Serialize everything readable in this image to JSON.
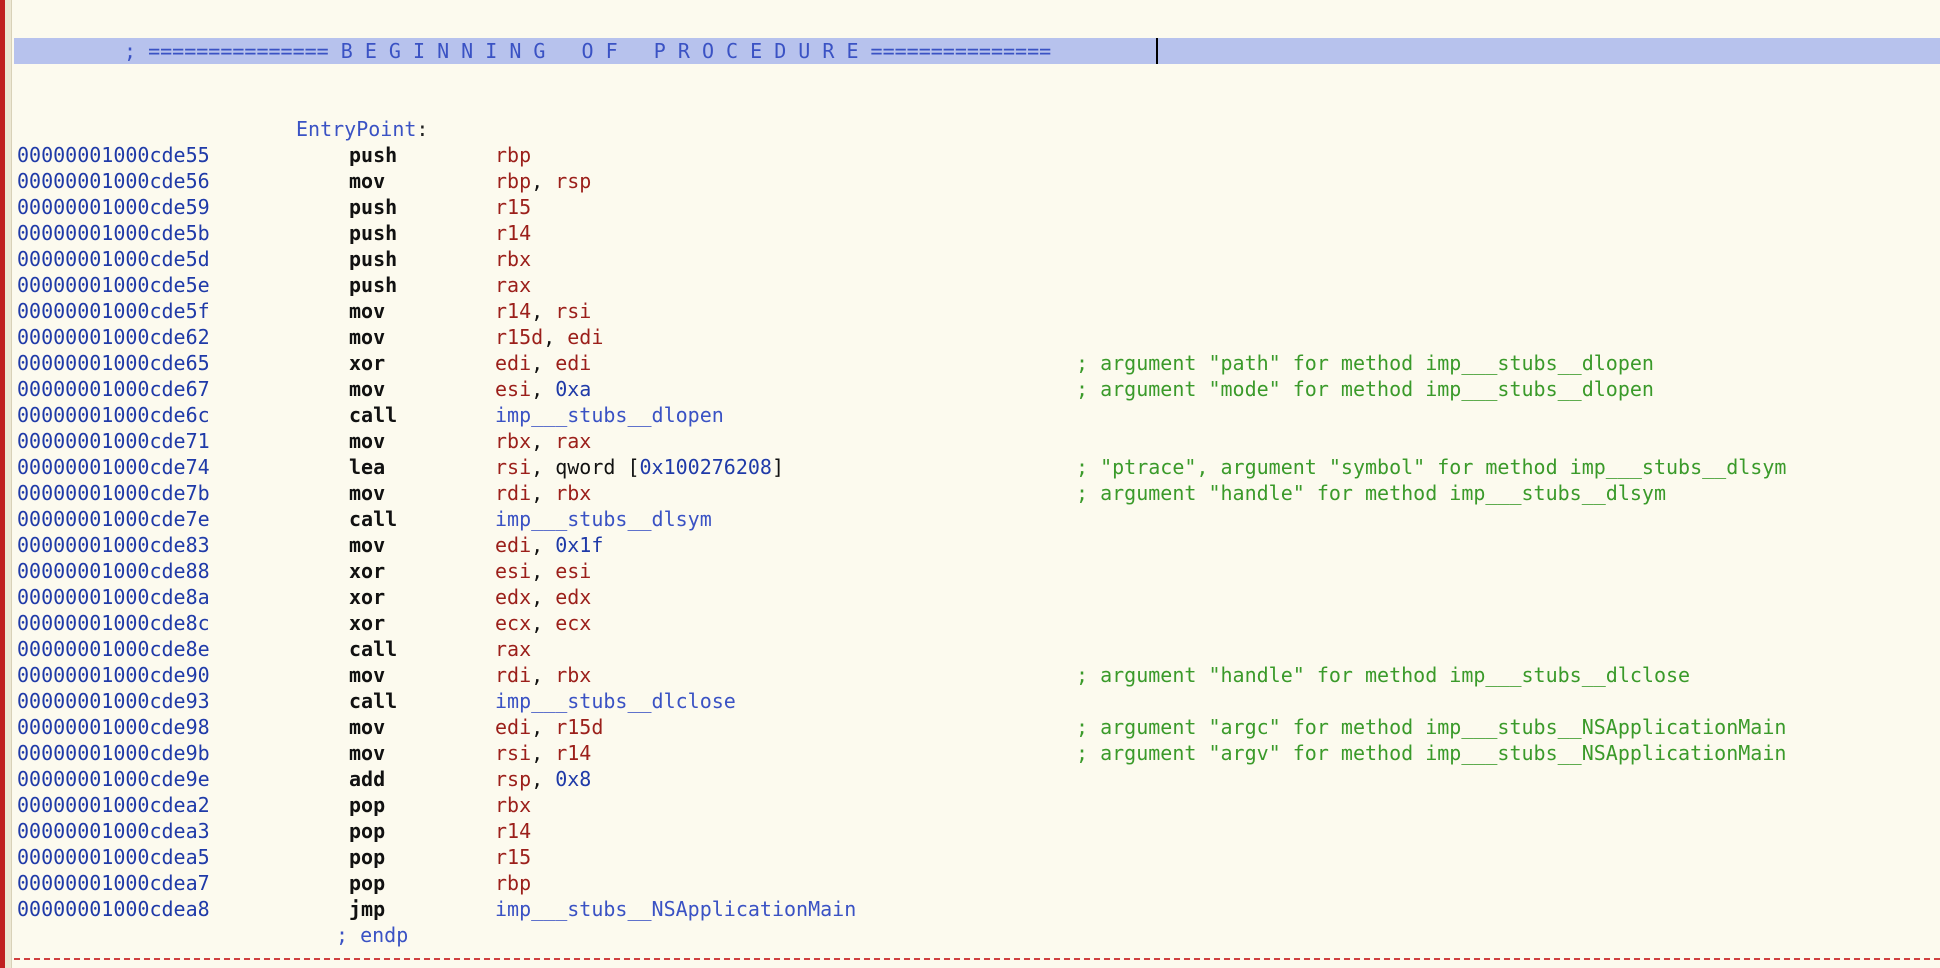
{
  "banner": {
    "text": "; =============== B E G I N N I N G   O F   P R O C E D U R E ==============="
  },
  "label": {
    "name": "EntryPoint",
    "colon": ":"
  },
  "instructions": [
    {
      "addr": "00000001000cde55",
      "mn": "push",
      "ops": [
        {
          "t": "reg",
          "v": "rbp"
        }
      ],
      "comment": ""
    },
    {
      "addr": "00000001000cde56",
      "mn": "mov",
      "ops": [
        {
          "t": "reg",
          "v": "rbp"
        },
        {
          "t": "sep",
          "v": ", "
        },
        {
          "t": "reg",
          "v": "rsp"
        }
      ],
      "comment": ""
    },
    {
      "addr": "00000001000cde59",
      "mn": "push",
      "ops": [
        {
          "t": "reg",
          "v": "r15"
        }
      ],
      "comment": ""
    },
    {
      "addr": "00000001000cde5b",
      "mn": "push",
      "ops": [
        {
          "t": "reg",
          "v": "r14"
        }
      ],
      "comment": ""
    },
    {
      "addr": "00000001000cde5d",
      "mn": "push",
      "ops": [
        {
          "t": "reg",
          "v": "rbx"
        }
      ],
      "comment": ""
    },
    {
      "addr": "00000001000cde5e",
      "mn": "push",
      "ops": [
        {
          "t": "reg",
          "v": "rax"
        }
      ],
      "comment": ""
    },
    {
      "addr": "00000001000cde5f",
      "mn": "mov",
      "ops": [
        {
          "t": "reg",
          "v": "r14"
        },
        {
          "t": "sep",
          "v": ", "
        },
        {
          "t": "reg",
          "v": "rsi"
        }
      ],
      "comment": ""
    },
    {
      "addr": "00000001000cde62",
      "mn": "mov",
      "ops": [
        {
          "t": "reg",
          "v": "r15d"
        },
        {
          "t": "sep",
          "v": ", "
        },
        {
          "t": "reg",
          "v": "edi"
        }
      ],
      "comment": ""
    },
    {
      "addr": "00000001000cde65",
      "mn": "xor",
      "ops": [
        {
          "t": "reg",
          "v": "edi"
        },
        {
          "t": "sep",
          "v": ", "
        },
        {
          "t": "reg",
          "v": "edi"
        }
      ],
      "comment": "; argument \"path\" for method imp___stubs__dlopen"
    },
    {
      "addr": "00000001000cde67",
      "mn": "mov",
      "ops": [
        {
          "t": "reg",
          "v": "esi"
        },
        {
          "t": "sep",
          "v": ", "
        },
        {
          "t": "num",
          "v": "0xa"
        }
      ],
      "comment": "; argument \"mode\" for method imp___stubs__dlopen"
    },
    {
      "addr": "00000001000cde6c",
      "mn": "call",
      "ops": [
        {
          "t": "sym",
          "v": "imp___stubs__dlopen"
        }
      ],
      "comment": ""
    },
    {
      "addr": "00000001000cde71",
      "mn": "mov",
      "ops": [
        {
          "t": "reg",
          "v": "rbx"
        },
        {
          "t": "sep",
          "v": ", "
        },
        {
          "t": "reg",
          "v": "rax"
        }
      ],
      "comment": ""
    },
    {
      "addr": "00000001000cde74",
      "mn": "lea",
      "ops": [
        {
          "t": "reg",
          "v": "rsi"
        },
        {
          "t": "sep",
          "v": ", "
        },
        {
          "t": "plain",
          "v": "qword ["
        },
        {
          "t": "num",
          "v": "0x100276208"
        },
        {
          "t": "plain",
          "v": "]"
        }
      ],
      "comment": "; \"ptrace\", argument \"symbol\" for method imp___stubs__dlsym"
    },
    {
      "addr": "00000001000cde7b",
      "mn": "mov",
      "ops": [
        {
          "t": "reg",
          "v": "rdi"
        },
        {
          "t": "sep",
          "v": ", "
        },
        {
          "t": "reg",
          "v": "rbx"
        }
      ],
      "comment": "; argument \"handle\" for method imp___stubs__dlsym"
    },
    {
      "addr": "00000001000cde7e",
      "mn": "call",
      "ops": [
        {
          "t": "sym",
          "v": "imp___stubs__dlsym"
        }
      ],
      "comment": ""
    },
    {
      "addr": "00000001000cde83",
      "mn": "mov",
      "ops": [
        {
          "t": "reg",
          "v": "edi"
        },
        {
          "t": "sep",
          "v": ", "
        },
        {
          "t": "num",
          "v": "0x1f"
        }
      ],
      "comment": ""
    },
    {
      "addr": "00000001000cde88",
      "mn": "xor",
      "ops": [
        {
          "t": "reg",
          "v": "esi"
        },
        {
          "t": "sep",
          "v": ", "
        },
        {
          "t": "reg",
          "v": "esi"
        }
      ],
      "comment": ""
    },
    {
      "addr": "00000001000cde8a",
      "mn": "xor",
      "ops": [
        {
          "t": "reg",
          "v": "edx"
        },
        {
          "t": "sep",
          "v": ", "
        },
        {
          "t": "reg",
          "v": "edx"
        }
      ],
      "comment": ""
    },
    {
      "addr": "00000001000cde8c",
      "mn": "xor",
      "ops": [
        {
          "t": "reg",
          "v": "ecx"
        },
        {
          "t": "sep",
          "v": ", "
        },
        {
          "t": "reg",
          "v": "ecx"
        }
      ],
      "comment": ""
    },
    {
      "addr": "00000001000cde8e",
      "mn": "call",
      "ops": [
        {
          "t": "reg",
          "v": "rax"
        }
      ],
      "comment": ""
    },
    {
      "addr": "00000001000cde90",
      "mn": "mov",
      "ops": [
        {
          "t": "reg",
          "v": "rdi"
        },
        {
          "t": "sep",
          "v": ", "
        },
        {
          "t": "reg",
          "v": "rbx"
        }
      ],
      "comment": "; argument \"handle\" for method imp___stubs__dlclose"
    },
    {
      "addr": "00000001000cde93",
      "mn": "call",
      "ops": [
        {
          "t": "sym",
          "v": "imp___stubs__dlclose"
        }
      ],
      "comment": ""
    },
    {
      "addr": "00000001000cde98",
      "mn": "mov",
      "ops": [
        {
          "t": "reg",
          "v": "edi"
        },
        {
          "t": "sep",
          "v": ", "
        },
        {
          "t": "reg",
          "v": "r15d"
        }
      ],
      "comment": "; argument \"argc\" for method imp___stubs__NSApplicationMain"
    },
    {
      "addr": "00000001000cde9b",
      "mn": "mov",
      "ops": [
        {
          "t": "reg",
          "v": "rsi"
        },
        {
          "t": "sep",
          "v": ", "
        },
        {
          "t": "reg",
          "v": "r14"
        }
      ],
      "comment": "; argument \"argv\" for method imp___stubs__NSApplicationMain"
    },
    {
      "addr": "00000001000cde9e",
      "mn": "add",
      "ops": [
        {
          "t": "reg",
          "v": "rsp"
        },
        {
          "t": "sep",
          "v": ", "
        },
        {
          "t": "num",
          "v": "0x8"
        }
      ],
      "comment": ""
    },
    {
      "addr": "00000001000cdea2",
      "mn": "pop",
      "ops": [
        {
          "t": "reg",
          "v": "rbx"
        }
      ],
      "comment": ""
    },
    {
      "addr": "00000001000cdea3",
      "mn": "pop",
      "ops": [
        {
          "t": "reg",
          "v": "r14"
        }
      ],
      "comment": ""
    },
    {
      "addr": "00000001000cdea5",
      "mn": "pop",
      "ops": [
        {
          "t": "reg",
          "v": "r15"
        }
      ],
      "comment": ""
    },
    {
      "addr": "00000001000cdea7",
      "mn": "pop",
      "ops": [
        {
          "t": "reg",
          "v": "rbp"
        }
      ],
      "comment": ""
    },
    {
      "addr": "00000001000cdea8",
      "mn": "jmp",
      "ops": [
        {
          "t": "sym",
          "v": "imp___stubs__NSApplicationMain"
        }
      ],
      "comment": ""
    }
  ],
  "endp": {
    "text": "; endp"
  },
  "colors": {
    "background": "#fcfaee",
    "banner_bg": "#b7c2ed",
    "address": "#1f3aa8",
    "register": "#9b1f1a",
    "symbol": "#3a52c4",
    "comment": "#3a9a2a",
    "gutter": "#c02020"
  }
}
